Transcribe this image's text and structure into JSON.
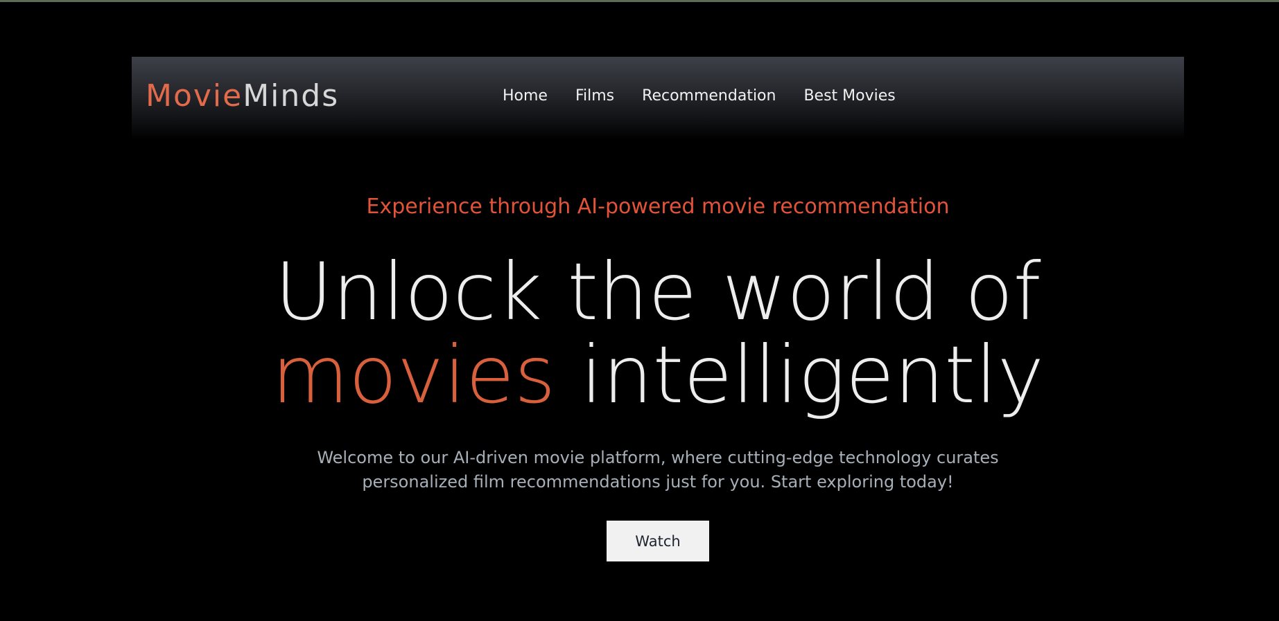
{
  "colors": {
    "accent": "#e2533a",
    "background": "#000000",
    "navbar_top": "#3d4048",
    "text_light": "#ededed",
    "text_muted": "#a7afb9",
    "button_bg": "#f1f1f1"
  },
  "brand": {
    "part1": "Movie",
    "part2": "Minds"
  },
  "nav": {
    "items": [
      {
        "label": "Home"
      },
      {
        "label": "Films"
      },
      {
        "label": "Recommendation"
      },
      {
        "label": "Best Movies"
      }
    ]
  },
  "hero": {
    "tagline": "Experience through AI-powered movie recommendation",
    "headline_line1": "Unlock the world of",
    "headline_accent": "movies",
    "headline_rest": " intelligently",
    "description_line1": "Welcome to our AI-driven movie platform, where cutting-edge technology curates",
    "description_line2": "personalized film recommendations just for you. Start exploring today!",
    "cta_label": "Watch"
  }
}
